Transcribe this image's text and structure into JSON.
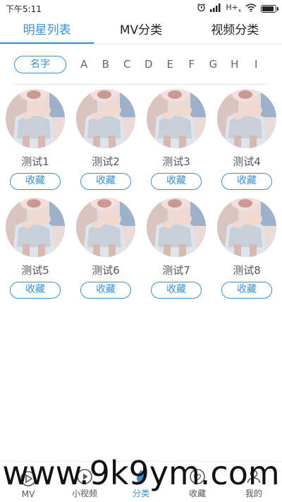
{
  "statusbar": {
    "time": "下午5:11",
    "network": "H+",
    "network_sub": "x"
  },
  "tabs": [
    {
      "label": "明星列表",
      "active": true
    },
    {
      "label": "MV分类",
      "active": false
    },
    {
      "label": "视频分类",
      "active": false
    }
  ],
  "filter": {
    "name_chip": "名字",
    "letters": [
      "A",
      "B",
      "C",
      "D",
      "E",
      "F",
      "G",
      "H",
      "I"
    ]
  },
  "stars": [
    {
      "name": "测试1",
      "fav_label": "收藏"
    },
    {
      "name": "测试2",
      "fav_label": "收藏"
    },
    {
      "name": "测试3",
      "fav_label": "收藏"
    },
    {
      "name": "测试4",
      "fav_label": "收藏"
    },
    {
      "name": "测试5",
      "fav_label": "收藏"
    },
    {
      "name": "测试6",
      "fav_label": "收藏"
    },
    {
      "name": "测试7",
      "fav_label": "收藏"
    },
    {
      "name": "测试8",
      "fav_label": "收藏"
    }
  ],
  "bottom_nav": [
    {
      "label": "MV",
      "icon": "mv-icon",
      "active": false
    },
    {
      "label": "小视频",
      "icon": "play-icon",
      "active": false
    },
    {
      "label": "分类",
      "icon": "category-icon",
      "active": true
    },
    {
      "label": "收藏",
      "icon": "favorite-icon",
      "active": false
    },
    {
      "label": "我的",
      "icon": "profile-icon",
      "active": false
    }
  ],
  "watermark": "www.9k9ym.com",
  "colors": {
    "accent": "#3a8fd0",
    "text": "#333333",
    "muted": "#666666"
  }
}
